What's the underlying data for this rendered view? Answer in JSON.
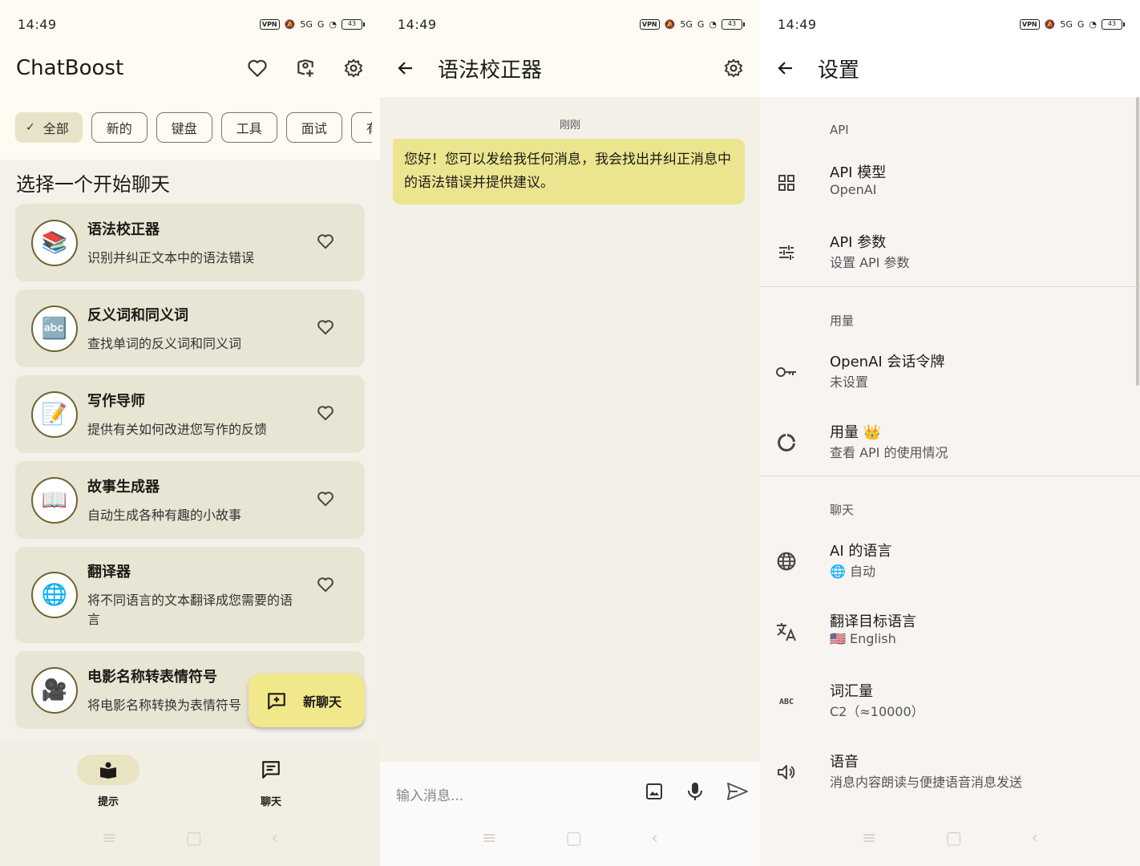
{
  "status": {
    "time": "14:49",
    "vpn": "VPN",
    "signal1": "5G",
    "signal2": "G",
    "battery": "43"
  },
  "screen1": {
    "app_title": "ChatBoost",
    "chips": [
      {
        "label": "全部",
        "selected": true
      },
      {
        "label": "新的"
      },
      {
        "label": "键盘"
      },
      {
        "label": "工具"
      },
      {
        "label": "面试"
      },
      {
        "label": "有"
      }
    ],
    "section_title": "选择一个开始聊天",
    "cards": [
      {
        "emoji": "📚",
        "name": "语法校正器",
        "desc": "识别并纠正文本中的语法错误"
      },
      {
        "emoji": "🔤",
        "name": "反义词和同义词",
        "desc": "查找单词的反义词和同义词"
      },
      {
        "emoji": "📝",
        "name": "写作导师",
        "desc": "提供有关如何改进您写作的反馈"
      },
      {
        "emoji": "📖",
        "name": "故事生成器",
        "desc": "自动生成各种有趣的小故事"
      },
      {
        "emoji": "🌐",
        "name": "翻译器",
        "desc": "将不同语言的文本翻译成您需要的语言"
      },
      {
        "emoji": "🎥",
        "name": "电影名称转表情符号",
        "desc": "将电影名称转换为表情符号"
      }
    ],
    "fab_label": "新聊天",
    "nav": [
      {
        "label": "提示",
        "icon": "prompt-book-icon"
      },
      {
        "label": "聊天",
        "icon": "chat-icon"
      }
    ]
  },
  "screen2": {
    "title": "语法校正器",
    "time_label": "刚刚",
    "message": "您好！您可以发给我任何消息，我会找出并纠正消息中的语法错误并提供建议。",
    "input_placeholder": "输入消息..."
  },
  "screen3": {
    "title": "设置",
    "groups": {
      "api": "API",
      "usage": "用量",
      "chat": "聊天"
    },
    "items": {
      "api_model": {
        "title": "API 模型",
        "sub": "OpenAI"
      },
      "api_params": {
        "title": "API 参数",
        "sub": "设置 API 参数"
      },
      "session_token": {
        "title": "OpenAI 会话令牌",
        "sub": "未设置"
      },
      "usage": {
        "title": "用量 👑",
        "sub": "查看 API 的使用情况"
      },
      "ai_lang": {
        "title": "AI 的语言",
        "sub": "🌐 自动"
      },
      "translate_target": {
        "title": "翻译目标语言",
        "sub": "🇺🇸 English"
      },
      "vocab": {
        "title": "词汇量",
        "sub": "C2（≈10000）"
      },
      "voice": {
        "title": "语音",
        "sub": "消息内容朗读与便捷语音消息发送"
      }
    },
    "abc_icon_text": "ABC"
  }
}
